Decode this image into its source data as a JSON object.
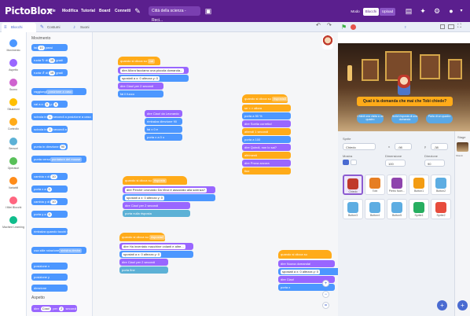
{
  "app": {
    "logo": "PictoBlox"
  },
  "menu": {
    "file": "File",
    "edit": "Modifica",
    "tutorials": "Tutorial",
    "boards": "Board",
    "connect": "Connetti",
    "project_title": "Città della scienza - Reci..."
  },
  "modes": {
    "mode": "Modo",
    "blocks": "Blocchi",
    "upload": "Upload"
  },
  "colors": {
    "topbar": "#5b1f8e",
    "accent": "#4a6bd1",
    "motion": "#4c97ff",
    "control": "#ffab19",
    "looks": "#9966ff",
    "sound": "#cf63cf",
    "sensing": "#5cb1d6",
    "myblocks": "#ff6680"
  },
  "tabs": {
    "code": "Blocchi",
    "costumes": "Costumi",
    "sounds": "Suoni"
  },
  "categories": [
    {
      "label": "Movimento",
      "color": "#4c97ff"
    },
    {
      "label": "Aspetto",
      "color": "#9966ff"
    },
    {
      "label": "Suono",
      "color": "#cf63cf"
    },
    {
      "label": "Situazioni",
      "color": "#ffbf00"
    },
    {
      "label": "Controllo",
      "color": "#ffab19"
    },
    {
      "label": "Sensori",
      "color": "#5cb1d6"
    },
    {
      "label": "Operatori",
      "color": "#59c059"
    },
    {
      "label": "Variabili",
      "color": "#ff8c1a"
    },
    {
      "label": "I Miei Blocchi",
      "color": "#ff6680"
    },
    {
      "label": "Machine Learning",
      "color": "#0fbd8c"
    }
  ],
  "palette": {
    "section1": "Movimento",
    "blocks": [
      {
        "kind": "motion",
        "label": "fai",
        "value": "10",
        "suffix": "passi"
      },
      {
        "kind": "motion",
        "label": "ruota ↻ di",
        "value": "15",
        "suffix": "gradi"
      },
      {
        "kind": "motion",
        "label": "ruota ↺ di",
        "value": "15",
        "suffix": "gradi"
      },
      {
        "kind": "motion",
        "label": "raggiungi",
        "drop": "posizione a caso"
      },
      {
        "kind": "motion",
        "label": "vai a x:",
        "value": "0",
        "suffix": "y:",
        "value2": "0"
      },
      {
        "kind": "motion",
        "label": "scivola in",
        "value": "1",
        "suffix": "secondi a posizione a caso"
      },
      {
        "kind": "motion",
        "label": "scivola in",
        "value": "1",
        "suffix": "secondi a x:"
      },
      {
        "kind": "motion",
        "label": "punta in direzione",
        "value": "90"
      },
      {
        "kind": "motion",
        "label": "punta verso",
        "drop": "puntatore del mouse"
      },
      {
        "kind": "motion",
        "label": "cambia x di",
        "value": "10"
      },
      {
        "kind": "motion",
        "label": "porta x a",
        "value": "0"
      },
      {
        "kind": "motion",
        "label": "cambia y di",
        "value": "10"
      },
      {
        "kind": "motion",
        "label": "porta y a",
        "value": "0"
      },
      {
        "kind": "motion",
        "label": "rimbalza quando tocchi il bordo"
      },
      {
        "kind": "motion",
        "label": "usa stile rotazione",
        "drop": "sinistra-destra"
      },
      {
        "kind": "motion",
        "label": "posizione x"
      },
      {
        "kind": "motion",
        "label": "posizione y"
      },
      {
        "kind": "motion",
        "label": "direzione"
      }
    ],
    "section2": "Aspetto",
    "looks_block": {
      "label": "dire",
      "value": "Ciao!",
      "mid": "per",
      "value2": "2",
      "suffix": "secondi"
    }
  },
  "scripts": {
    "s1": {
      "hat": "quando si clicca su",
      "hat_drop": "vai",
      "lines": [
        "dire Allora facciamo una piccola domanda...",
        "spostati a x: 0 altezza y: 0",
        "dire Ciao! per 2 secondi",
        "fai il fuoco"
      ]
    },
    "s2": {
      "lines": [
        "dire Ciao! da Leonardo",
        "rimbalza direzione 90",
        "fai x 0 e",
        "porta x a 0 o"
      ]
    },
    "s3": {
      "hat": "quando si clicca su",
      "hat_drop": "risposta",
      "lines": [
        "dire Perché Leonardo Da Vinci è associato alla scienza?",
        "spostati a x: 0 altezza y: 0",
        "dire Ciao! per 2 secondi",
        "porta nulla risposta"
      ]
    },
    "s4": {
      "hat": "quando si clicca su",
      "hat_drop": "risposta2",
      "lines": [
        "dire Ha inventato macchine volanti e altre...",
        "spostati a x: 0 altezza y: 0",
        "dire Ciao! per 2 secondi",
        "porta fine"
      ]
    },
    "s5": {
      "hat": "quando si clicca su",
      "hat_drop": "risposta3",
      "lines": [
        "se < > allora",
        "porta a 50 %",
        "dire Scelta corretta!",
        "attendi 1 secondi",
        "porta a 100",
        "dire Quindi, non lo sai?",
        "altrimenti",
        "dire Prova ancora",
        "fine"
      ]
    },
    "s6": {
      "lines": [
        "dire Le frasi di Leonardo...",
        "spostati a x: 0 altezza y: 0",
        "dire Ciao! per 2 secondi",
        "porta x a 0"
      ]
    },
    "s7": {
      "hat": "quando si clicca su",
      "lines": [
        "dire Nuova domanda!",
        "spostati a x: 0 altezza y: 0",
        "dire Ciao!",
        "porta x"
      ]
    }
  },
  "stage": {
    "question": "Qual è la domanda che mai che Tobi chiede?",
    "answers": [
      "Chiedi una visita a un quadro",
      "Scrivi risposta di una domanda",
      "Parla di un quadro"
    ]
  },
  "sprite_info": {
    "sprite_label": "Sprite",
    "sprite_name": "Chiedo",
    "x_label": "x",
    "x_value": "-98",
    "y_label": "y",
    "y_value": "-38",
    "show_label": "Mostra",
    "size_label": "Dimensione",
    "size_value": "100",
    "direction_label": "Direzione",
    "direction_value": "90"
  },
  "sprites": [
    "Chiedo",
    "Tobi",
    "Pietro Nom...",
    "Button1",
    "Button2",
    "Button3",
    "Button4",
    "Button5",
    "Sprite1",
    "Sprite2"
  ],
  "stage_pane": {
    "label": "Stage",
    "backdrops": "Sfondi"
  }
}
